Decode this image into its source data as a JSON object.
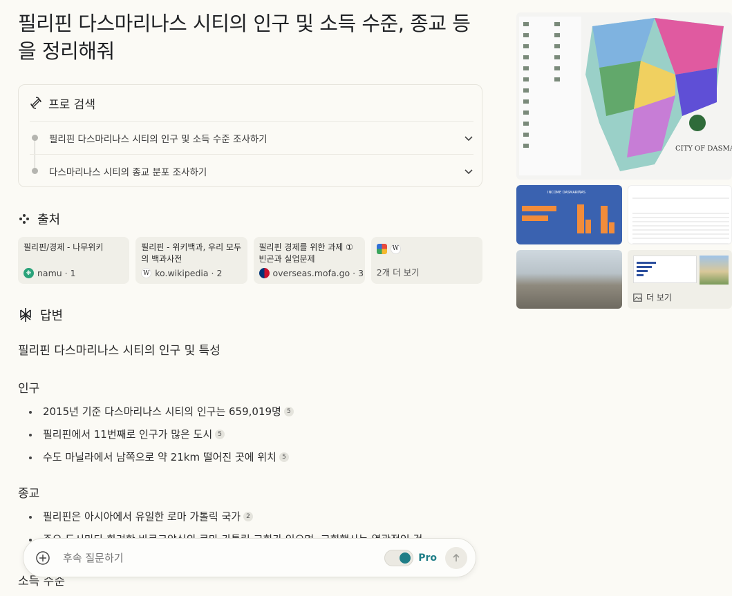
{
  "title": "필리핀 다스마리나스 시티의 인구 및 소득 수준, 종교 등을 정리해줘",
  "pro_search": {
    "label": "프로 검색",
    "steps": [
      "필리핀 다스마리나스 시티의 인구 및 소득 수준 조사하기",
      "다스마리나스 시티의 종교 분포 조사하기"
    ]
  },
  "sources": {
    "heading": "출처",
    "items": [
      {
        "title": "필리핀/경제 - 나무위키",
        "site": "namu · 1"
      },
      {
        "title": "필리핀 - 위키백과, 우리 모두의 백과사전",
        "site": "ko.wikipedia · 2"
      },
      {
        "title": "필리핀 경제를 위한 과제 ① 빈곤과 실업문제",
        "site": "overseas.mofa.go · 3"
      }
    ],
    "more": "2개 더 보기"
  },
  "answer": {
    "heading": "답변",
    "intro": "필리핀 다스마리나스 시티의 인구 및 특성",
    "population_heading": "인구",
    "population_items": [
      {
        "text": "2015년 기준 다스마리나스 시티의 인구는 659,019명",
        "cite": "5"
      },
      {
        "text": "필리핀에서 11번째로 인구가 많은 도시",
        "cite": "5"
      },
      {
        "text": "수도 마닐라에서 남쪽으로 약 21km 떨어진 곳에 위치",
        "cite": "5"
      }
    ],
    "religion_heading": "종교",
    "religion_items": [
      {
        "text": "필리핀은 아시아에서 유일한 로마 가톨릭 국가",
        "cite": "2"
      },
      {
        "text": "주요 도시마다 화려한 바로크양식의 로마 가톨릭 교회가 있으며, 교회행사는 열광적인 것",
        "cite": ""
      }
    ],
    "income_heading": "소득 수준"
  },
  "followup": {
    "placeholder": "후속 질문하기",
    "pro_label": "Pro"
  },
  "gallery": {
    "more_label": "더 보기",
    "map_caption": "CITY OF DASMARIÑAS",
    "chart_caption": "INCOME DASMARIÑAS"
  }
}
